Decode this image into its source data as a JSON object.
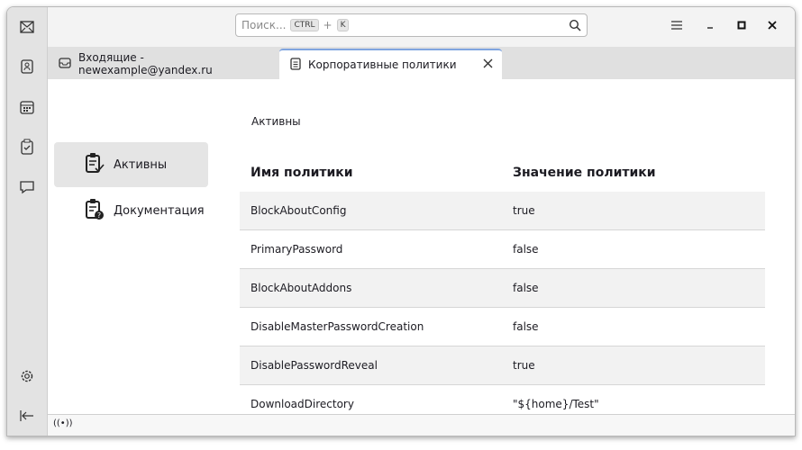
{
  "search": {
    "placeholder": "Поиск...",
    "key1": "CTRL",
    "plus": "+",
    "key2": "K"
  },
  "tabs": [
    {
      "label": "Входящие - newexample@yandex.ru"
    },
    {
      "label": "Корпоративные политики"
    }
  ],
  "nav": [
    {
      "label": "Активны"
    },
    {
      "label": "Документация"
    }
  ],
  "section_title": "Активны",
  "table": {
    "headers": [
      "Имя политики",
      "Значение политики"
    ],
    "rows": [
      [
        "BlockAboutConfig",
        "true"
      ],
      [
        "PrimaryPassword",
        "false"
      ],
      [
        "BlockAboutAddons",
        "false"
      ],
      [
        "DisableMasterPasswordCreation",
        "false"
      ],
      [
        "DisablePasswordReveal",
        "true"
      ],
      [
        "DownloadDirectory",
        "\"${home}/Test\""
      ]
    ]
  },
  "status": {
    "icon": "((•))"
  }
}
